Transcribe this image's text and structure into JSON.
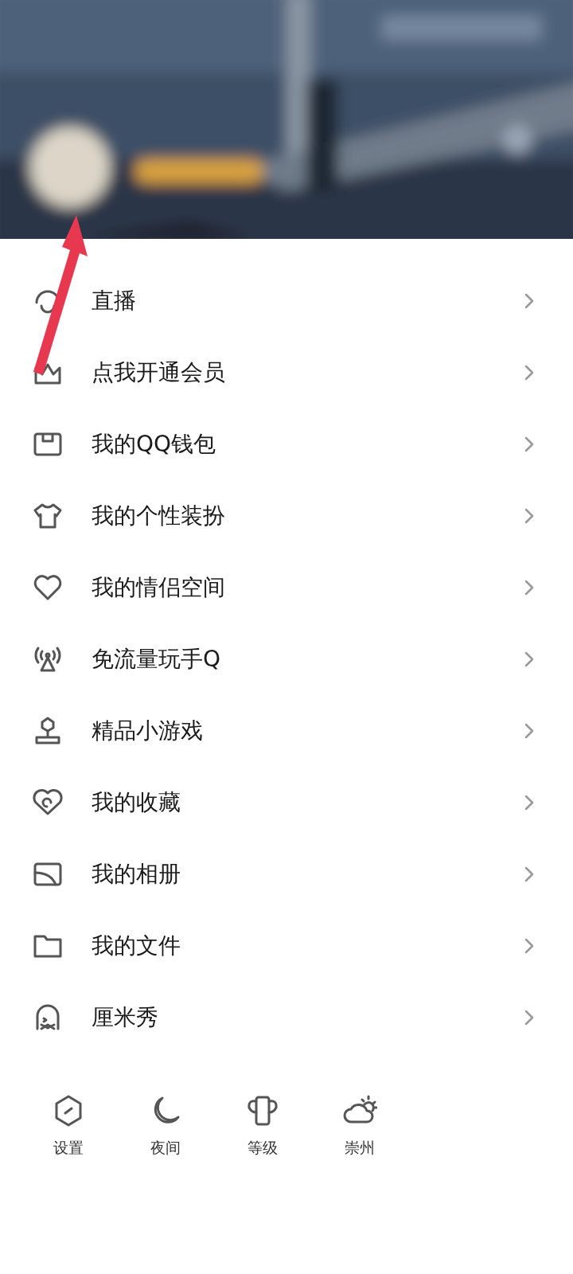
{
  "menu": [
    {
      "label": "直播"
    },
    {
      "label": "点我开通会员"
    },
    {
      "label": "我的QQ钱包"
    },
    {
      "label": "我的个性装扮"
    },
    {
      "label": "我的情侣空间"
    },
    {
      "label": "免流量玩手Q"
    },
    {
      "label": "精品小游戏"
    },
    {
      "label": "我的收藏"
    },
    {
      "label": "我的相册"
    },
    {
      "label": "我的文件"
    },
    {
      "label": "厘米秀"
    }
  ],
  "bottom_bar": [
    {
      "label": "设置"
    },
    {
      "label": "夜间"
    },
    {
      "label": "等级"
    },
    {
      "label": "崇州"
    }
  ]
}
